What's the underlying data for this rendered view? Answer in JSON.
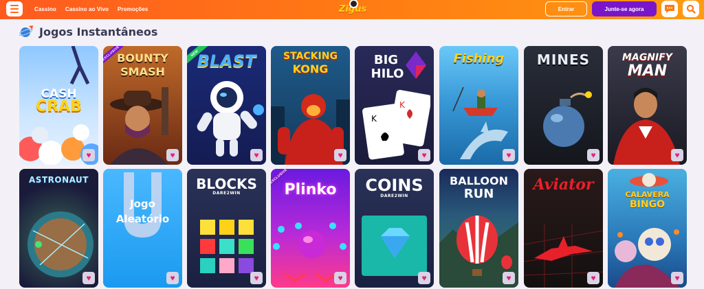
{
  "header": {
    "nav": [
      "Cassino",
      "Cassino ao Vivo",
      "Promoções"
    ],
    "logo": "Zigus",
    "login_label": "Entrar",
    "join_label": "Junte-se agora",
    "icons": [
      "menu-icon",
      "chat-icon",
      "search-icon"
    ]
  },
  "section": {
    "title": "Jogos Instantâneos",
    "icon": "rocket-planet-icon"
  },
  "games": [
    {
      "title_line1": "CASH",
      "title_line2": "CRAB",
      "badge": ""
    },
    {
      "title_line1": "BOUNTY",
      "title_line2": "SMASH",
      "badge": "EXCLUSIVE"
    },
    {
      "title_line1": "BLAST",
      "title_line2": "",
      "badge": "NEW"
    },
    {
      "title_line1": "STACKING",
      "title_line2": "KONG",
      "badge": ""
    },
    {
      "title_line1": "BIG",
      "title_line2": "HILO",
      "badge": ""
    },
    {
      "title_line1": "Fishing",
      "title_line2": "",
      "badge": ""
    },
    {
      "title_line1": "MINES",
      "title_line2": "",
      "badge": ""
    },
    {
      "title_line1": "MAGNIFY",
      "title_line2": "MAN",
      "badge": ""
    },
    {
      "title_line1": "ASTRONAUT",
      "title_line2": "",
      "badge": ""
    },
    {
      "title_line1": "Jogo",
      "title_line2": "Aleatório",
      "badge": ""
    },
    {
      "title_line1": "BLOCKS",
      "title_line2": "DARE2WIN",
      "badge": ""
    },
    {
      "title_line1": "Plinko",
      "title_line2": "",
      "badge": "EXCLUSIVE"
    },
    {
      "title_line1": "COINS",
      "title_line2": "DARE2WIN",
      "badge": ""
    },
    {
      "title_line1": "BALLOON",
      "title_line2": "RUN",
      "badge": ""
    },
    {
      "title_line1": "Aviator",
      "title_line2": "",
      "badge": ""
    },
    {
      "title_line1": "CALAVERA",
      "title_line2": "BINGO",
      "badge": ""
    }
  ],
  "colors": {
    "header": "#ff6a1a",
    "join": "#7a16c9",
    "heart": "#e0237a"
  }
}
